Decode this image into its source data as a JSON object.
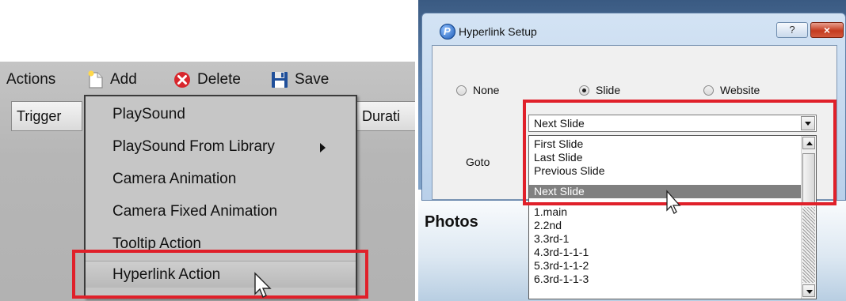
{
  "left_panel": {
    "toolbar": {
      "actions_label": "Actions",
      "add_label": "Add",
      "delete_label": "Delete",
      "save_label": "Save"
    },
    "columns": {
      "trigger": "Trigger",
      "duration": "Durati"
    },
    "menu": {
      "items": [
        {
          "label": "PlaySound"
        },
        {
          "label": "PlaySound From Library"
        },
        {
          "label": "Camera Animation"
        },
        {
          "label": "Camera Fixed Animation"
        },
        {
          "label": "Tooltip Action"
        },
        {
          "label": "Hyperlink Action"
        }
      ]
    }
  },
  "dialog": {
    "title": "Hyperlink Setup",
    "help_label": "?",
    "close_label": "×",
    "radios": {
      "none": "None",
      "slide": "Slide",
      "website": "Website",
      "selected": "Slide"
    },
    "goto_label": "Goto",
    "combo_value": "Next Slide",
    "dropdown_options": [
      "First Slide",
      "Last Slide",
      "Previous Slide",
      "Next Slide",
      "1.main",
      "2.2nd",
      "3.3rd-1",
      "4.3rd-1-1-1",
      "5.3rd-1-1-2",
      "6.3rd-1-1-3"
    ],
    "selected_option": "Next Slide"
  },
  "background": {
    "photos_label": "Photos"
  },
  "colors": {
    "highlight_box": "#e0202a",
    "selected_item": "#808080",
    "delete_icon": "#d8262c",
    "save_icon": "#1f4f9a"
  }
}
